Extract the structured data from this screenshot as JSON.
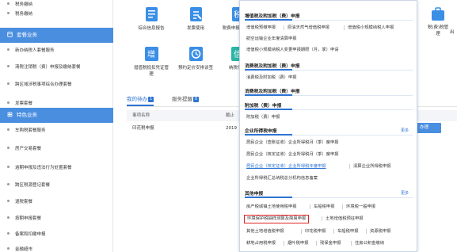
{
  "sidebar": {
    "top_item": "税务缴纳",
    "section1": "套餐业务",
    "section1_items": [
      "新办纳税人套餐服务",
      "清税注销税（费）申报及缴纳套餐",
      "跨区域涉税事项综合办理套餐",
      "发票套餐"
    ],
    "section2": "特色业务",
    "section2_items": [
      "车购税套餐服务",
      "房产交易套餐",
      "逾期申报及违法行为处置套餐",
      "跨区税源登记套餐",
      "退税套餐",
      "按期申报套餐",
      "备案和扣缴申报",
      "金融超市"
    ]
  },
  "tiles_row1": [
    {
      "label": "综合信息报告",
      "color": "#3a8ee6"
    },
    {
      "label": "发票使用",
      "color": "#3a8ee6"
    },
    {
      "label": "税费申报及缴纳",
      "color": "#3a8ee6"
    }
  ],
  "tiles_row2": [
    {
      "label": "增值税抵扣凭证管理",
      "color": "#3a8ee6"
    },
    {
      "label": "预约定价安排谈签",
      "color": "#3a8ee6"
    },
    {
      "label": "纳税信用",
      "color": "#2ab5a5"
    }
  ],
  "right_tiles": {
    "t1": "税(费)税管理",
    "t2": "出"
  },
  "tabs": [
    {
      "label": "我的待办",
      "badge": "1"
    },
    {
      "label": "服务提醒",
      "badge": "0"
    }
  ],
  "table": {
    "headers": [
      "事项名称",
      "截止",
      "操作"
    ],
    "rows": [
      {
        "name": "印花税申报",
        "date": "2019",
        "action": "办理"
      }
    ]
  },
  "panel": {
    "sec1": {
      "title": "增值税及附加税（费）申报",
      "rows": [
        [
          "增值税预缴申报",
          "原油天然气增值税申报",
          "增值税小规模纳税人申报"
        ],
        [
          "航空运输企业年度清算申报"
        ],
        [
          "增值税小规模纳税人变更申报期限（月，季）申请"
        ]
      ]
    },
    "sec2": {
      "title": "消费税及附加税（费）申报",
      "rows": [
        [
          "消费税及附加税（费）申报"
        ]
      ]
    },
    "sec3": {
      "title": "消费税及附加税（费）申报",
      "rows": [
        [
          "通用申报（税及附征）"
        ]
      ]
    },
    "sec4": {
      "title": "附加税（费）申报",
      "rows": [
        [
          "附加税（费）申报"
        ]
      ]
    },
    "sec5": {
      "title": "企业所得税申报",
      "more": "更多",
      "rows": [
        [
          "居民企业（查账征收）企业所得税月（季）度申报"
        ],
        [
          "居民企业（核定征收）企业所得税月（季）度申报"
        ],
        [
          "居民企业（核定征收）企业所得税年度申报",
          "清算企业所得税申报"
        ],
        [
          "企业所得税汇总纳税总分机构信息备案"
        ]
      ]
    },
    "sec6": {
      "title": "其他申报",
      "more": "更多",
      "rows": [
        [
          "房产税城镇土地使用税申报",
          "车船税申报",
          "环境税一般申报"
        ],
        [
          "环境保护税抽样测算及简易申报",
          "土地增值税预征申报"
        ],
        [
          "其他土地增值税申报",
          "印花税申报",
          "车船税申报",
          "资源税申报"
        ],
        [
          "耕地占用税申报",
          "烟叶税申报",
          "残保金申报",
          "住房公积金缴纳"
        ]
      ]
    }
  }
}
